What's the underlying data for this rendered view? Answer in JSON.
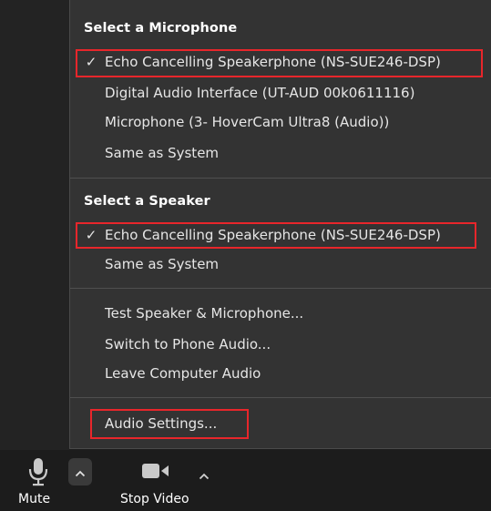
{
  "audio_menu": {
    "microphone_header": "Select a Microphone",
    "microphones": [
      {
        "label": "Echo Cancelling Speakerphone (NS-SUE246-DSP)",
        "selected": true
      },
      {
        "label": "Digital Audio Interface (UT-AUD 00k0611116)",
        "selected": false
      },
      {
        "label": "Microphone (3- HoverCam Ultra8 (Audio))",
        "selected": false
      },
      {
        "label": "Same as System",
        "selected": false
      }
    ],
    "speaker_header": "Select a Speaker",
    "speakers": [
      {
        "label": "Echo Cancelling Speakerphone (NS-SUE246-DSP)",
        "selected": true
      },
      {
        "label": "Same as System",
        "selected": false
      }
    ],
    "actions": [
      {
        "label": "Test Speaker & Microphone..."
      },
      {
        "label": "Switch to Phone Audio..."
      },
      {
        "label": "Leave Computer Audio"
      }
    ],
    "settings_label": "Audio Settings...",
    "check_glyph": "✓",
    "highlight_color": "#e8262b"
  },
  "toolbar": {
    "mute_label": "Mute",
    "stop_video_label": "Stop Video"
  }
}
